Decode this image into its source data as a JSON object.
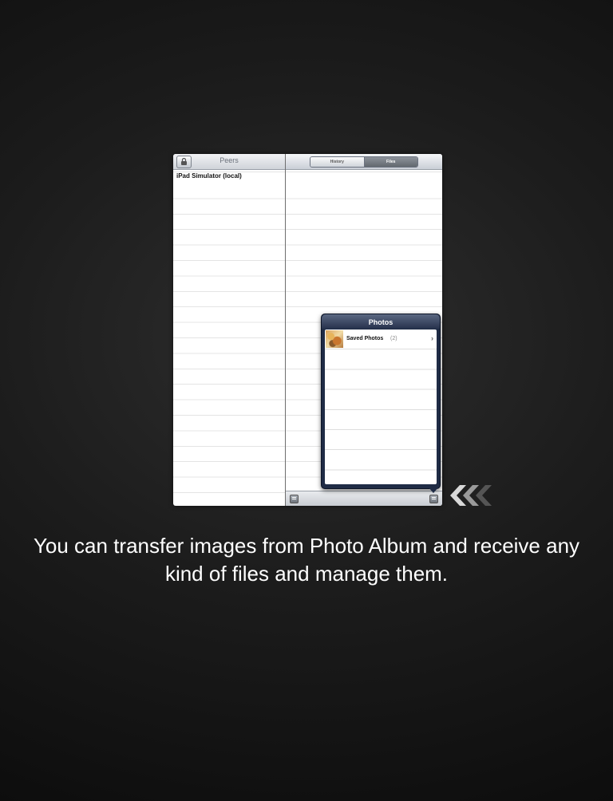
{
  "left_pane": {
    "title": "Peers",
    "lock_button_icon": "lock-icon",
    "rows": [
      "iPad Simulator (local)"
    ]
  },
  "right_pane": {
    "segments": [
      "History",
      "Files"
    ],
    "selected_segment": "Files",
    "toolbar": {
      "left_icon": "list-icon",
      "right_icon": "action-icon"
    }
  },
  "popover": {
    "title": "Photos",
    "items": [
      {
        "label": "Saved Photos",
        "count": "(2)",
        "icon": "photo-thumbnail"
      }
    ]
  },
  "indicator_icon": "triple-chevron-left-icon",
  "caption": {
    "line1": "You can transfer images from Photo Album and receive any",
    "line2": "kind of files and manage them."
  }
}
